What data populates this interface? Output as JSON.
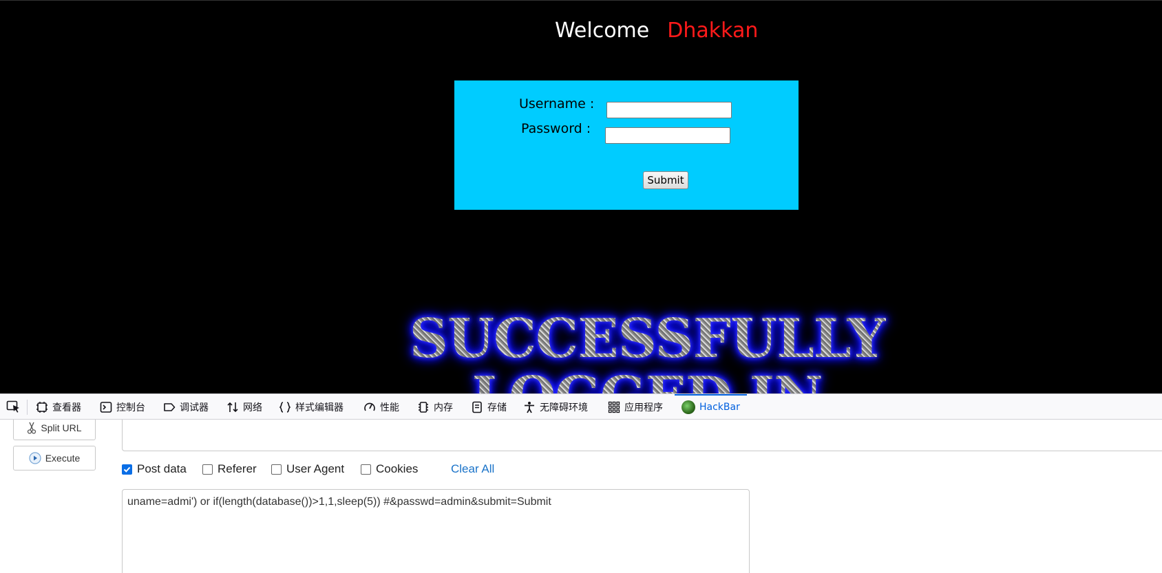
{
  "page": {
    "welcome_label": "Welcome",
    "welcome_name": "Dhakkan",
    "username_label": "Username :",
    "password_label": "Password :",
    "username_value": "",
    "password_value": "",
    "submit_label": "Submit",
    "banner_line1": "SUCCESSFULLY",
    "banner_line2": "LOGGED IN",
    "colors": {
      "page_bg": "#000000",
      "login_box": "#00ccff",
      "name_red": "#ff1a1a",
      "banner_glow": "#1a1aff"
    }
  },
  "devtools": {
    "tabs": [
      {
        "label": "查看器",
        "icon": "inspector-icon"
      },
      {
        "label": "控制台",
        "icon": "console-icon"
      },
      {
        "label": "调试器",
        "icon": "debugger-icon"
      },
      {
        "label": "网络",
        "icon": "network-icon"
      },
      {
        "label": "样式编辑器",
        "icon": "style-editor-icon"
      },
      {
        "label": "性能",
        "icon": "performance-icon"
      },
      {
        "label": "内存",
        "icon": "memory-icon"
      },
      {
        "label": "存储",
        "icon": "storage-icon"
      },
      {
        "label": "无障碍环境",
        "icon": "accessibility-icon"
      },
      {
        "label": "应用程序",
        "icon": "application-icon"
      },
      {
        "label": "HackBar",
        "icon": "hackbar-icon",
        "active": true
      }
    ],
    "accent": "#0060df"
  },
  "hackbar": {
    "split_url_label": "Split URL",
    "execute_label": "Execute",
    "url_value": "",
    "options": [
      {
        "label": "Post data",
        "checked": true
      },
      {
        "label": "Referer",
        "checked": false
      },
      {
        "label": "User Agent",
        "checked": false
      },
      {
        "label": "Cookies",
        "checked": false
      }
    ],
    "clear_all_label": "Clear All",
    "post_body": "uname=admi') or if(length(database())>1,1,sleep(5)) #&passwd=admin&submit=Submit"
  }
}
